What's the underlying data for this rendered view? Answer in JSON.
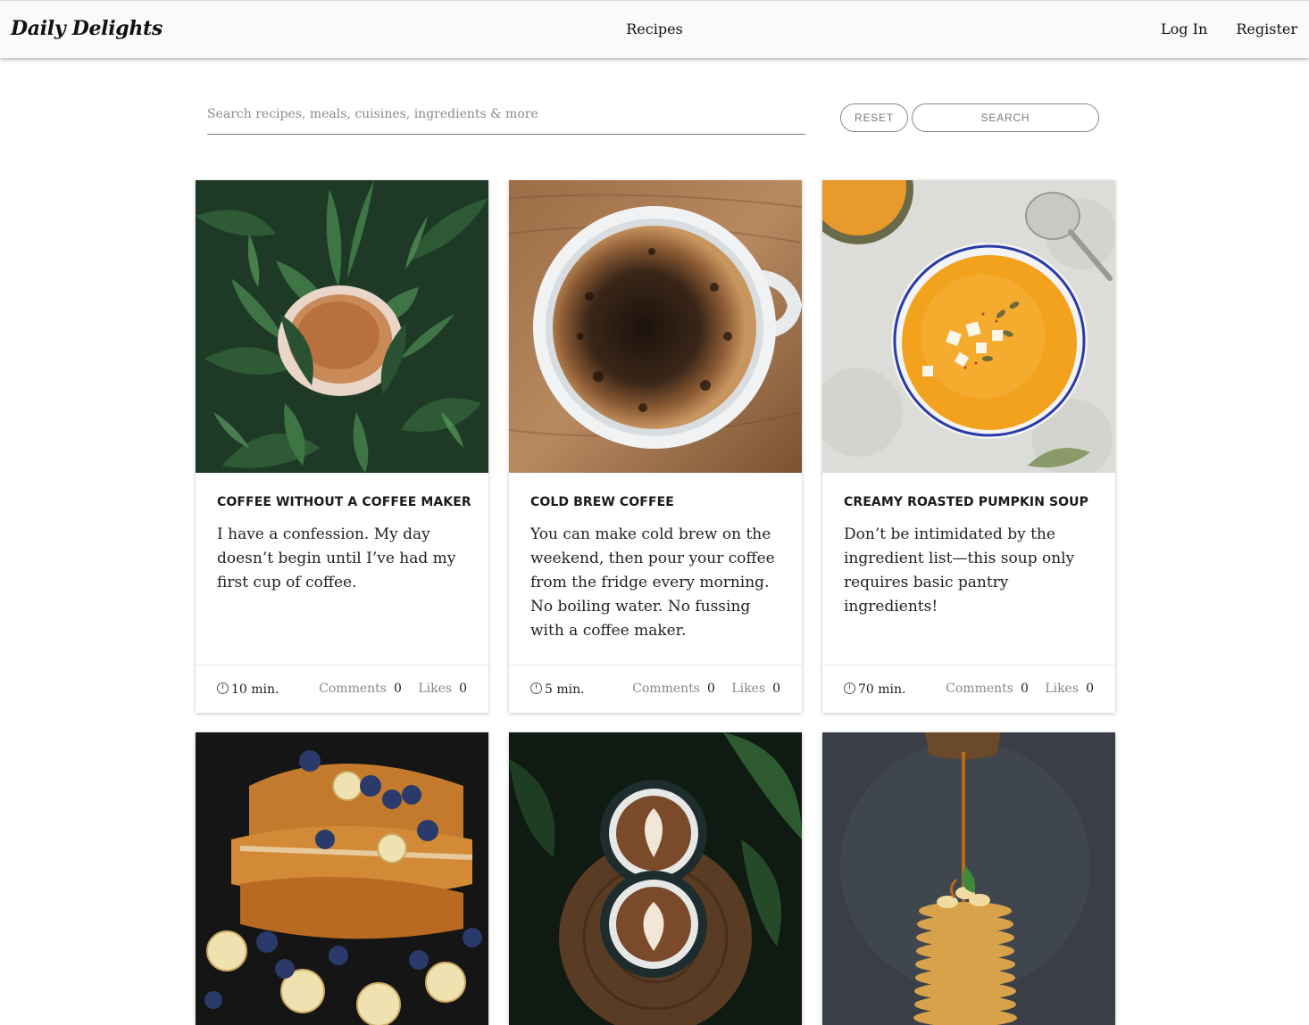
{
  "header": {
    "brand": "Daily Delights",
    "nav_center": "Recipes",
    "login": "Log In",
    "register": "Register"
  },
  "search": {
    "placeholder": "Search recipes, meals, cuisines, ingredients & more",
    "reset_label": "RESET",
    "search_label": "SEARCH"
  },
  "labels": {
    "comments": "Comments",
    "likes": "Likes"
  },
  "cards": [
    {
      "title": "COFFEE WITHOUT A COFFEE MAKER",
      "description": "I have a confession. My day doesn’t begin until I’ve had my first cup of coffee.",
      "time": "10 min.",
      "comments": "0",
      "likes": "0",
      "image": "tea cup among green leaves"
    },
    {
      "title": "COLD BREW COFFEE",
      "description": "You can make cold brew on the weekend, then pour your coffee from the fridge every morning. No boiling water. No fussing with a coffee maker.",
      "time": "5 min.",
      "comments": "0",
      "likes": "0",
      "image": "cup of coffee on wooden table"
    },
    {
      "title": "CREAMY ROASTED PUMPKIN SOUP",
      "description": "Don’t be intimidated by the ingredient list—this soup only requires basic pantry ingredients!",
      "time": "70 min.",
      "comments": "0",
      "likes": "0",
      "image": "bowl of pumpkin soup"
    },
    {
      "image": "french toast with blueberries and bananas"
    },
    {
      "image": "two latte art coffee cups on wooden board"
    },
    {
      "image": "stack of pancakes with syrup"
    }
  ],
  "colors": {
    "nav_bg": "#fafafa",
    "text": "#222222",
    "muted": "#888888",
    "button_border": "#8a8a8a"
  }
}
